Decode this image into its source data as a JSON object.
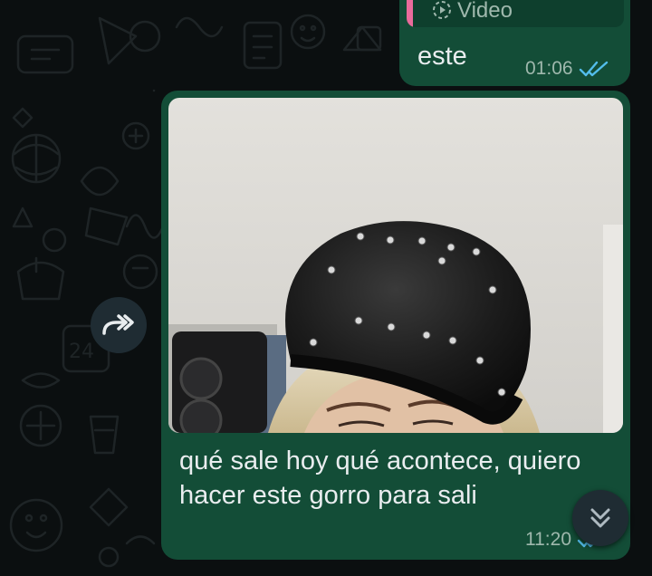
{
  "messages": [
    {
      "quoted": {
        "label": "Video",
        "icon": "video-icon",
        "accent_color": "#e96b9b"
      },
      "text": "este",
      "time": "01:06",
      "status_icon": "double-check-read-icon"
    },
    {
      "media": {
        "type": "image",
        "subject": "person-wearing-black-studded-leather-beret"
      },
      "text": "qué sale hoy qué acontece, quiero hacer este gorro para sali",
      "time": "11:20",
      "status_icon": "double-check-read-icon"
    }
  ],
  "controls": {
    "forward_icon": "forward-icon",
    "scroll_down_icon": "chevron-double-down-icon"
  },
  "colors": {
    "background": "#0b0f10",
    "bubble_outgoing": "#134d37",
    "text": "#e9edef",
    "meta_text": "#9fb8ad",
    "read_ticks": "#53bdeb"
  }
}
